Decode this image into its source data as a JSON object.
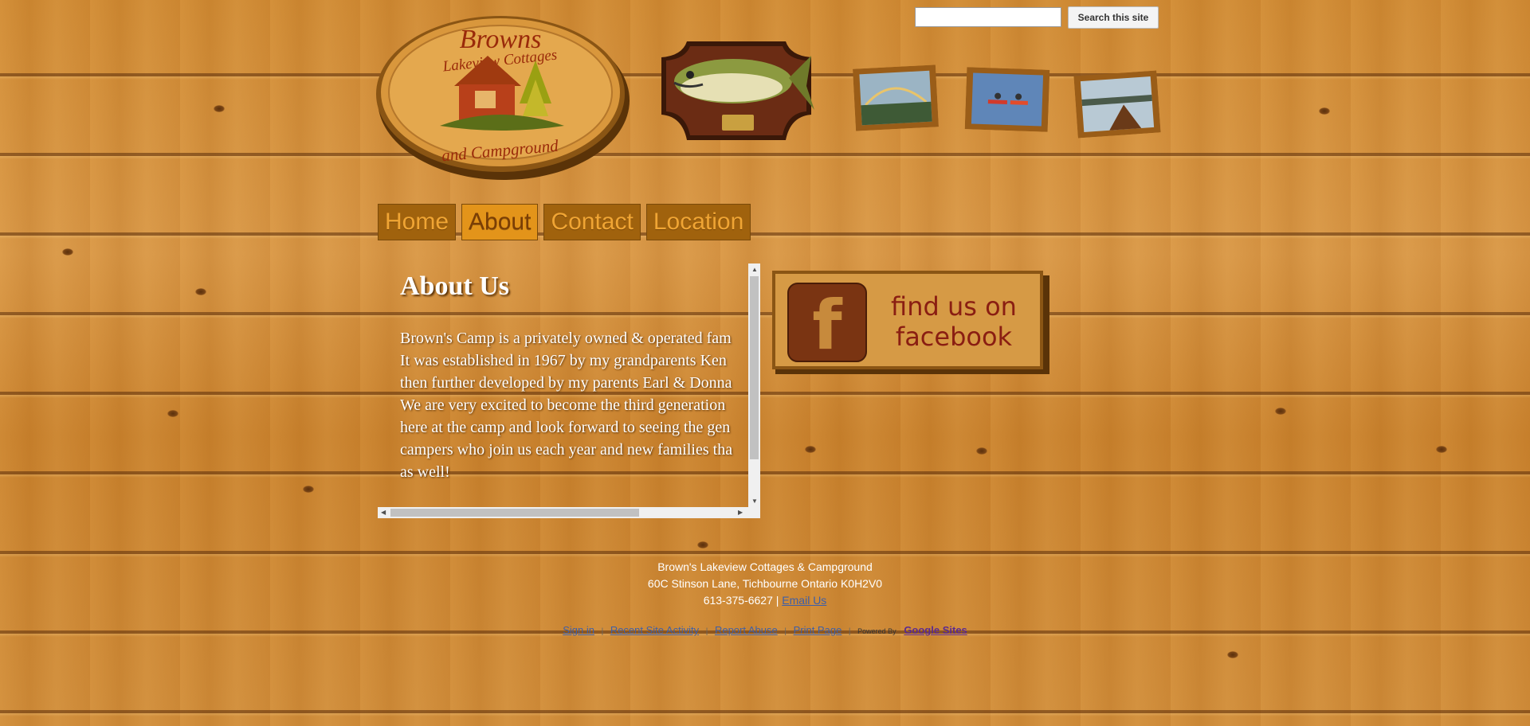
{
  "search": {
    "input_value": "",
    "button_label": "Search this site"
  },
  "logo": {
    "line1": "Browns",
    "line2": "Lakeview Cottages",
    "line3": "and Campground"
  },
  "nav": {
    "items": [
      {
        "label": "Home",
        "active": false
      },
      {
        "label": "About",
        "active": true
      },
      {
        "label": "Contact",
        "active": false
      },
      {
        "label": "Location",
        "active": false
      }
    ]
  },
  "main": {
    "title": "About Us",
    "lines": [
      "Brown's Camp is a privately owned & operated fam",
      "It was established in 1967 by my grandparents Ken",
      "then further developed by my parents Earl & Donna",
      "We are very excited to become the third generation",
      "here at the camp and look forward to seeing the gen",
      "campers who join us each year and new families tha",
      "as well!"
    ]
  },
  "facebook": {
    "line1": "find us on",
    "line2": "facebook",
    "glyph": "f"
  },
  "footer": {
    "name": "Brown's Lakeview Cottages & Campground",
    "address": "60C Stinson Lane, Tichbourne Ontario K0H2V0",
    "phone": "613-375-6627 |",
    "email_label": "Email Us"
  },
  "footer_links": {
    "sign_in": "Sign in",
    "recent_activity": "Recent Site Activity",
    "report_abuse": "Report Abuse",
    "print_page": "Print Page",
    "powered_by": "Powered By",
    "google_sites": "Google Sites",
    "separator": "|"
  }
}
